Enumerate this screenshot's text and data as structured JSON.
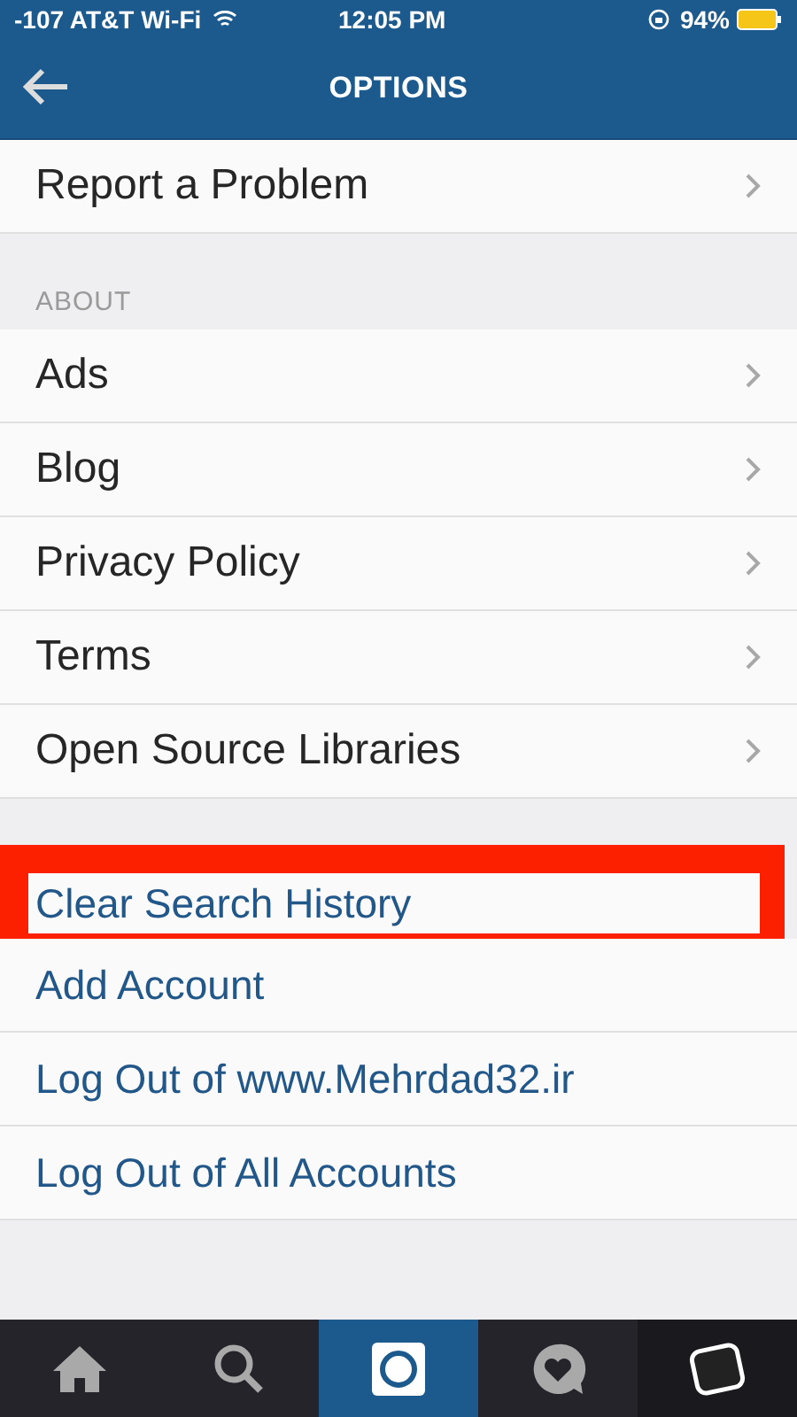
{
  "status_bar": {
    "carrier": "-107 AT&T Wi-Fi",
    "time": "12:05 PM",
    "battery": "94%"
  },
  "nav_bar": {
    "title": "OPTIONS"
  },
  "sections": [
    {
      "items": [
        {
          "label": "Report a Problem",
          "kind": "nav",
          "highlighted": false
        }
      ]
    },
    {
      "header": "ABOUT",
      "items": [
        {
          "label": "Ads",
          "kind": "nav",
          "highlighted": false
        },
        {
          "label": "Blog",
          "kind": "nav",
          "highlighted": false
        },
        {
          "label": "Privacy Policy",
          "kind": "nav",
          "highlighted": false
        },
        {
          "label": "Terms",
          "kind": "nav",
          "highlighted": false
        },
        {
          "label": "Open Source Libraries",
          "kind": "nav",
          "highlighted": false
        }
      ]
    },
    {
      "items": [
        {
          "label": "Clear Search History",
          "kind": "action",
          "highlighted": true
        },
        {
          "label": "Add Account",
          "kind": "action",
          "highlighted": false
        },
        {
          "label": "Log Out of www.Mehrdad32.ir",
          "kind": "action",
          "highlighted": false
        },
        {
          "label": "Log Out of All Accounts",
          "kind": "action",
          "highlighted": false
        }
      ]
    }
  ],
  "tab_bar": [
    {
      "selected": false
    },
    {
      "selected": false
    },
    {
      "selected": true
    },
    {
      "selected": false
    },
    {
      "selected": false
    }
  ]
}
